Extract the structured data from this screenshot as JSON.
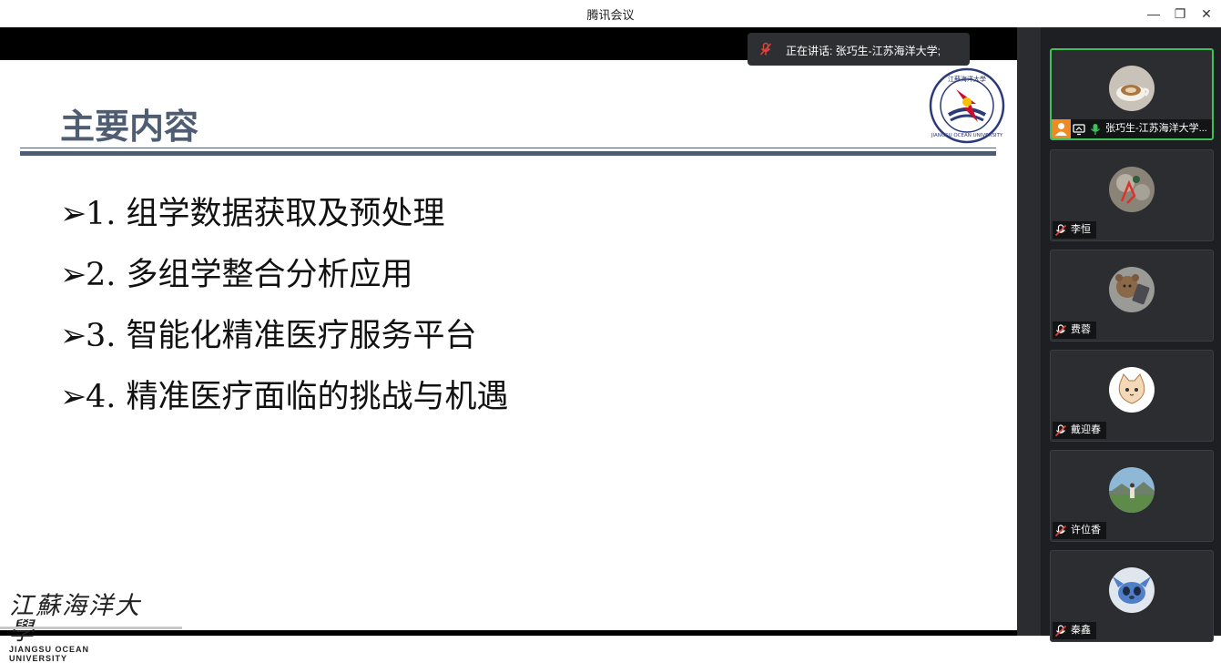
{
  "window": {
    "title": "腾讯会议",
    "minimize_glyph": "—",
    "restore_glyph": "❐",
    "close_glyph": "✕"
  },
  "speaker_toast": {
    "text": "正在讲话: 张巧生-江苏海洋大学;",
    "icon": "mic-muted-icon"
  },
  "slide": {
    "title": "主要内容",
    "items": [
      {
        "marker": "➢",
        "text": "1.  组学数据获取及预处理"
      },
      {
        "marker": "➢",
        "text": "2.  多组学整合分析应用"
      },
      {
        "marker": "➢",
        "text": "3.  智能化精准医疗服务平台"
      },
      {
        "marker": "➢",
        "text": "4.  精准医疗面临的挑战与机遇"
      }
    ],
    "footer": {
      "cn": "江蘇海洋大學",
      "en": "JIANGSU   OCEAN   UNIVERSITY"
    },
    "accent_color": "#4f5d73"
  },
  "participants": [
    {
      "name": "张巧生-江苏海洋大学...",
      "status": "active",
      "icons": [
        "host-icon",
        "screen-share-icon",
        "mic-on-icon"
      ],
      "avatar": "coffee-avatar"
    },
    {
      "name": "李恒",
      "status": "muted",
      "icons": [
        "mic-muted-icon"
      ],
      "avatar": "figure-avatar"
    },
    {
      "name": "费蓉",
      "status": "muted",
      "icons": [
        "mic-muted-icon"
      ],
      "avatar": "bear-avatar"
    },
    {
      "name": "戴迎春",
      "status": "muted",
      "icons": [
        "mic-muted-icon"
      ],
      "avatar": "cat-avatar"
    },
    {
      "name": "许位香",
      "status": "muted",
      "icons": [
        "mic-muted-icon"
      ],
      "avatar": "landscape-avatar"
    },
    {
      "name": "秦鑫",
      "status": "muted",
      "icons": [
        "mic-muted-icon"
      ],
      "avatar": "stitch-avatar"
    }
  ],
  "colors": {
    "active_border": "#3fc15a",
    "panel_bg": "#1e1f22",
    "muted_red": "#e0443a"
  }
}
